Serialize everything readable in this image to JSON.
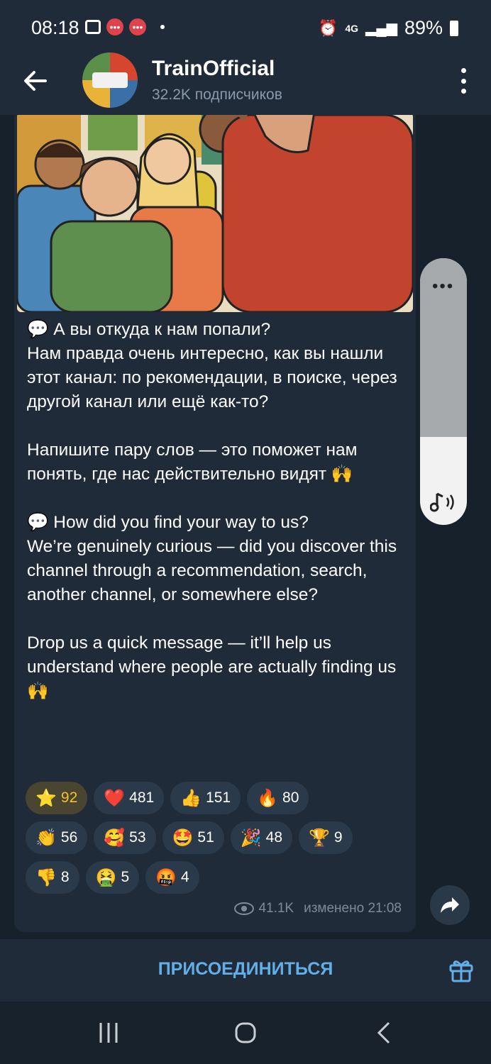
{
  "status_bar": {
    "time": "08:18",
    "network": "4G",
    "battery": "89%"
  },
  "header": {
    "title": "TrainOfficial",
    "subtitle": "32.2K подписчиков"
  },
  "message": {
    "paragraphs": [
      "💬 А вы откуда к нам попали?\nНам правда очень интересно, как вы нашли этот канал: по рекомендации, в поиске, через другой канал или ещё как-то?",
      "Напишите пару слов — это поможет нам понять, где нас действительно видят 🙌",
      "💬 How did you find your way to us?\nWe’re genuinely curious — did you discover this channel through a recommendation, search, another channel, or somewhere else?",
      "Drop us a quick message — it’ll help us understand where people are actually finding us 🙌"
    ],
    "reactions": [
      [
        {
          "emoji": "⭐",
          "count": "92",
          "selected": true
        },
        {
          "emoji": "❤️",
          "count": "481"
        },
        {
          "emoji": "👍",
          "count": "151"
        },
        {
          "emoji": "🔥",
          "count": "80"
        }
      ],
      [
        {
          "emoji": "👏",
          "count": "56"
        },
        {
          "emoji": "🥰",
          "count": "53"
        },
        {
          "emoji": "🤩",
          "count": "51"
        },
        {
          "emoji": "🎉",
          "count": "48"
        },
        {
          "emoji": "🏆",
          "count": "9"
        }
      ],
      [
        {
          "emoji": "👎",
          "count": "8"
        },
        {
          "emoji": "🤮",
          "count": "5"
        },
        {
          "emoji": "🤬",
          "count": "4"
        }
      ]
    ],
    "views": "41.1K",
    "edited": "изменено 21:08"
  },
  "join_button": {
    "label": "ПРИСОЕДИНИТЬСЯ"
  },
  "volume_panel": {
    "more": "•••",
    "level": 0.33
  },
  "colors": {
    "accent": "#63aee6",
    "bubble": "#1f2b38",
    "background": "#17212b"
  }
}
